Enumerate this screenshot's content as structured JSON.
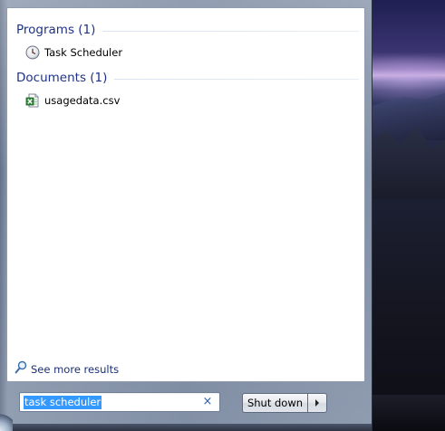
{
  "results": {
    "groups": [
      {
        "title": "Programs (1)",
        "items": [
          {
            "label": "Task Scheduler",
            "icon": "clock-icon"
          }
        ]
      },
      {
        "title": "Documents (1)",
        "items": [
          {
            "label": "usagedata.csv",
            "icon": "excel-file-icon"
          }
        ]
      }
    ],
    "see_more_label": "See more results"
  },
  "search": {
    "value": "task scheduler",
    "clear_glyph": "×"
  },
  "shutdown": {
    "label": "Shut down"
  },
  "colors": {
    "group_title": "#1e3287",
    "selection": "#3399ff",
    "frame": "#6d7d96"
  }
}
